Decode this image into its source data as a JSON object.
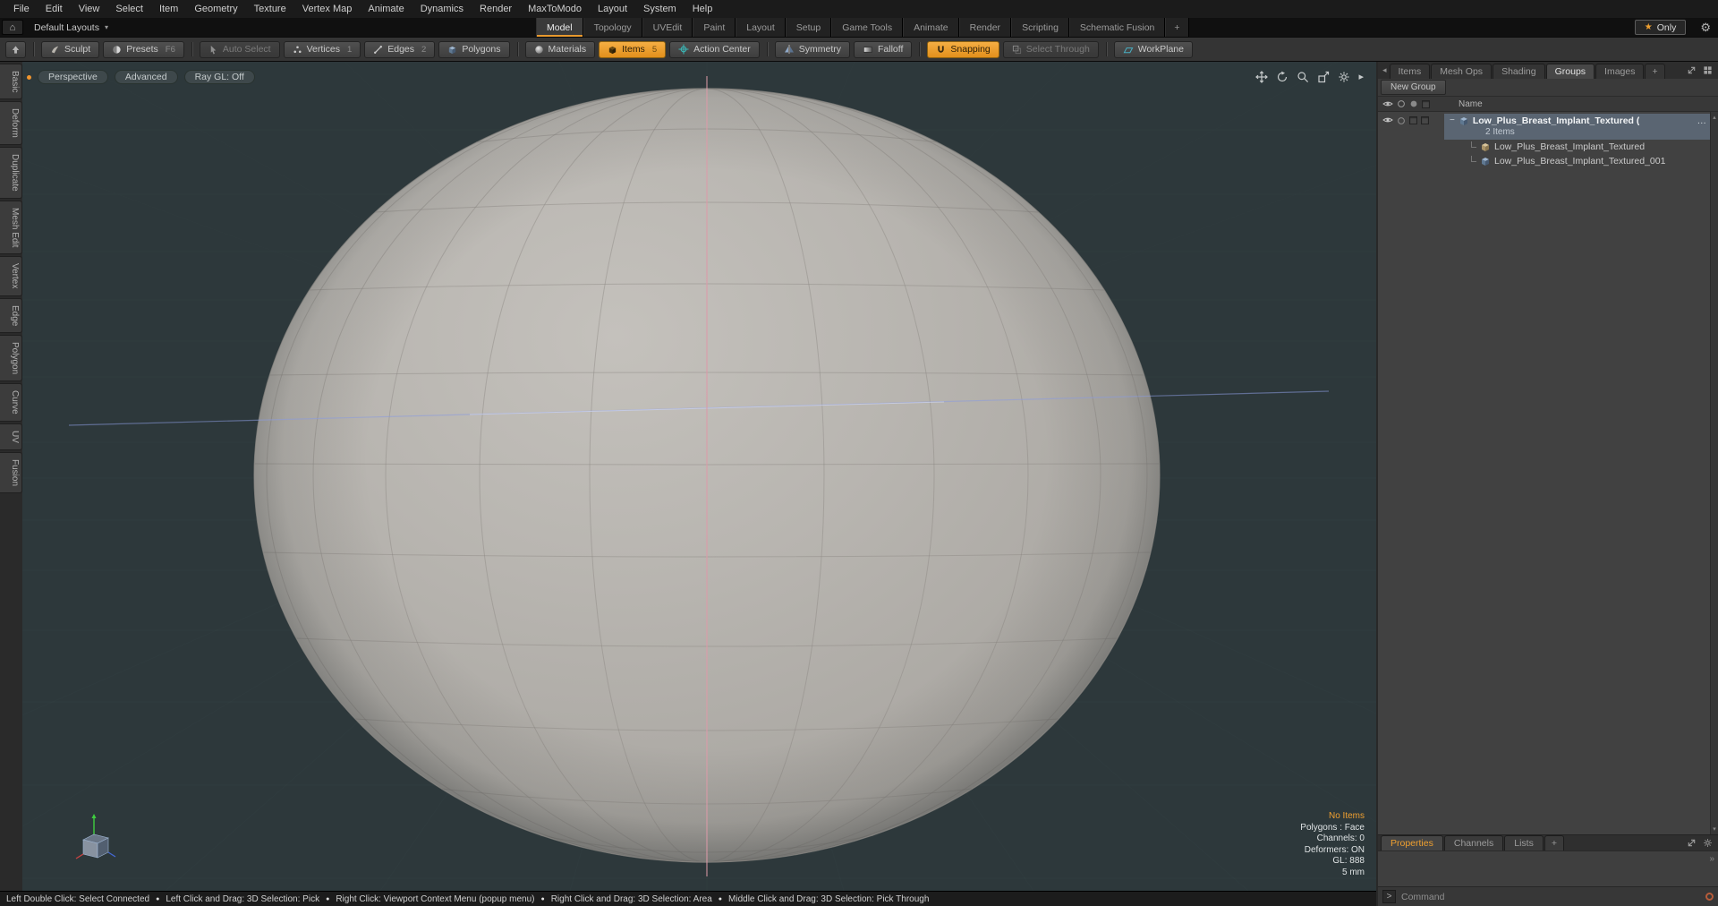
{
  "colors": {
    "accent": "#f0a030",
    "viewport_bg": "#2d383b",
    "selection": "#5a6572"
  },
  "menubar": {
    "items": [
      "File",
      "Edit",
      "View",
      "Select",
      "Item",
      "Geometry",
      "Texture",
      "Vertex Map",
      "Animate",
      "Dynamics",
      "Render",
      "MaxToModo",
      "Layout",
      "System",
      "Help"
    ]
  },
  "layout_bar": {
    "layouts_dropdown": "Default Layouts",
    "tabs": [
      "Model",
      "Topology",
      "UVEdit",
      "Paint",
      "Layout",
      "Setup",
      "Game Tools",
      "Animate",
      "Render",
      "Scripting",
      "Schematic Fusion"
    ],
    "add_tab": "+",
    "active_tab": "Model",
    "only_label": "Only"
  },
  "toolbar": {
    "sculpt": "Sculpt",
    "presets": "Presets",
    "presets_key": "F6",
    "auto_select": "Auto Select",
    "vertices": "Vertices",
    "vertices_key": "1",
    "edges": "Edges",
    "edges_key": "2",
    "polygons": "Polygons",
    "materials": "Materials",
    "items": "Items",
    "items_key": "5",
    "action_center": "Action Center",
    "symmetry": "Symmetry",
    "falloff": "Falloff",
    "snapping": "Snapping",
    "select_through": "Select Through",
    "workplane": "WorkPlane"
  },
  "left_tabs": [
    "Basic",
    "Deform",
    "Duplicate",
    "Mesh Edit",
    "Vertex",
    "Edge",
    "Polygon",
    "Curve",
    "UV",
    "Fusion"
  ],
  "viewport": {
    "camera_button": "Perspective",
    "shading_button": "Advanced",
    "raygl_button": "Ray GL: Off",
    "info": {
      "no_items": "No Items",
      "mode": "Polygons : Face",
      "channels": "Channels: 0",
      "deformers": "Deformers: ON",
      "gl": "GL: 888",
      "grid": "5 mm"
    }
  },
  "right_panel": {
    "tabs": [
      "Items",
      "Mesh Ops",
      "Shading",
      "Groups",
      "Images"
    ],
    "add_tab": "+",
    "active_tab": "Groups",
    "new_group_button": "New Group",
    "name_header": "Name",
    "group": {
      "label": "Low_Plus_Breast_Implant_Textured (",
      "overflow": "…",
      "count": "2 Items"
    },
    "children": [
      "Low_Plus_Breast_Implant_Textured",
      "Low_Plus_Breast_Implant_Textured_001"
    ],
    "bottom_tabs": [
      "Properties",
      "Channels",
      "Lists"
    ],
    "bottom_add_tab": "+",
    "active_bottom_tab": "Properties",
    "command": {
      "prompt": ">",
      "placeholder": "Command"
    }
  },
  "status_bar": {
    "segments": [
      "Left Double Click: Select Connected",
      "Left Click and Drag: 3D Selection: Pick",
      "Right Click: Viewport Context Menu (popup menu)",
      "Right Click and Drag: 3D Selection: Area",
      "Middle Click and Drag: 3D Selection: Pick Through"
    ]
  }
}
